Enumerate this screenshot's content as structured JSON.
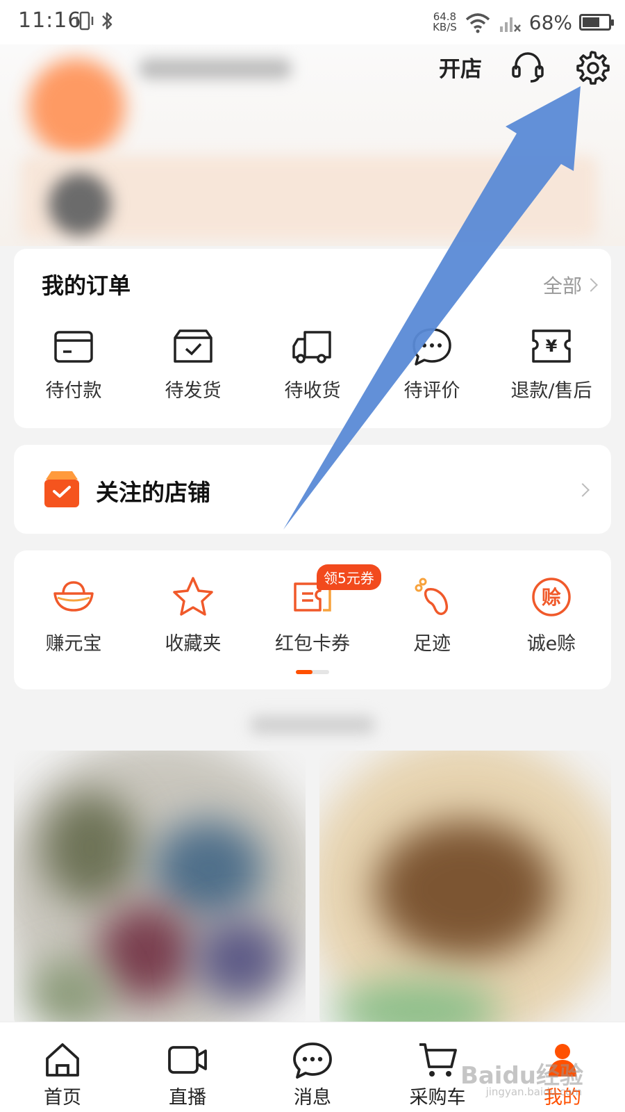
{
  "status_bar": {
    "time": "11:16",
    "network_speed_top": "64.8",
    "network_speed_bottom": "KB/S",
    "battery_percent": "68%",
    "battery_level": 0.68
  },
  "header": {
    "open_store_label": "开店",
    "support_icon": "headset-icon",
    "settings_icon": "gear-icon"
  },
  "orders": {
    "title": "我的订单",
    "all_label": "全部",
    "items": [
      {
        "label": "待付款",
        "icon": "wallet-icon"
      },
      {
        "label": "待发货",
        "icon": "package-icon"
      },
      {
        "label": "待收货",
        "icon": "truck-icon"
      },
      {
        "label": "待评价",
        "icon": "chat-icon"
      },
      {
        "label": "退款/售后",
        "icon": "refund-icon"
      }
    ]
  },
  "followed_stores": {
    "title": "关注的店铺",
    "icon": "store-bag-icon"
  },
  "tools": {
    "items": [
      {
        "label": "赚元宝",
        "icon": "gold-ingot-icon"
      },
      {
        "label": "收藏夹",
        "icon": "star-icon"
      },
      {
        "label": "红包卡券",
        "icon": "coupon-icon",
        "badge": "领5元券"
      },
      {
        "label": "足迹",
        "icon": "footprint-icon"
      },
      {
        "label": "诚e赊",
        "icon": "credit-icon",
        "glyph": "赊"
      }
    ],
    "pager_active": 1,
    "pager_total": 2
  },
  "bottom_nav": {
    "items": [
      {
        "label": "首页",
        "icon": "home-icon"
      },
      {
        "label": "直播",
        "icon": "video-icon"
      },
      {
        "label": "消息",
        "icon": "message-icon"
      },
      {
        "label": "采购车",
        "icon": "cart-icon"
      },
      {
        "label": "我的",
        "icon": "profile-icon",
        "active": true
      }
    ]
  },
  "watermark": {
    "text": "Baidu经验",
    "sub": "jingyan.baidu.com"
  },
  "colors": {
    "accent": "#ff5000",
    "badge": "#f24a1d",
    "arrow": "#5a8ad6"
  }
}
